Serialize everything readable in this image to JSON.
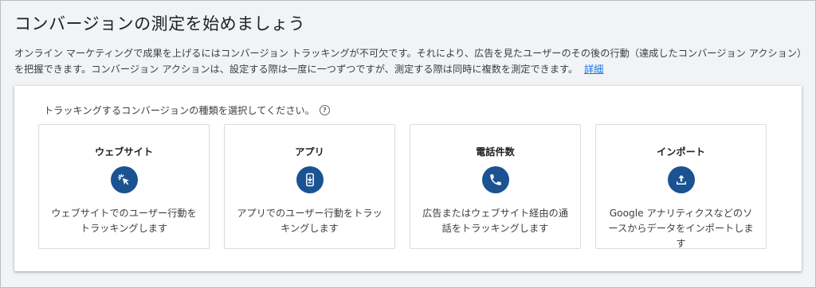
{
  "header": {
    "title": "コンバージョンの測定を始めましょう"
  },
  "intro": {
    "text": "オンライン マーケティングで成果を上げるにはコンバージョン トラッキングが不可欠です。それにより、広告を見たユーザーのその後の行動（達成したコンバージョン アクション）を把握できます。コンバージョン アクションは、設定する際は一度に一つずつですが、測定する際は同時に複数を測定できます。",
    "link_label": "詳細"
  },
  "selection": {
    "prompt": "トラッキングするコンバージョンの種類を選択してください。",
    "help_icon": "help-circle-icon",
    "cards": [
      {
        "title": "ウェブサイト",
        "icon": "cursor-click-icon",
        "description": "ウェブサイトでのユーザー行動をトラッキングします"
      },
      {
        "title": "アプリ",
        "icon": "phone-download-icon",
        "description": "アプリでのユーザー行動をトラッキングします"
      },
      {
        "title": "電話件数",
        "icon": "phone-call-icon",
        "description": "広告またはウェブサイト経由の通話をトラッキングします"
      },
      {
        "title": "インポート",
        "icon": "upload-icon",
        "description": "Google アナリティクスなどのソースからデータをインポートします"
      }
    ]
  },
  "colors": {
    "accent": "#1a5292",
    "link": "#1a73e8",
    "background": "#f1f3f4"
  }
}
